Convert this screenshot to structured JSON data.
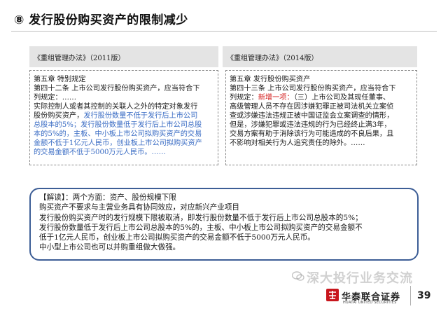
{
  "title": "⑧ 发行股份购买资产的限制减少",
  "columns": {
    "left_header": "《重组管理办法》（2011版）",
    "right_header": "《重组管理办法》（2014版）"
  },
  "left_box": {
    "lines": [
      {
        "segments": [
          {
            "text": "第五章 特别规定",
            "style": "plain"
          }
        ]
      },
      {
        "segments": [
          {
            "text": "第四十二条 上市公司发行股份购买资产，应当符合下",
            "style": "plain"
          }
        ]
      },
      {
        "segments": [
          {
            "text": "列规定：……",
            "style": "plain"
          }
        ]
      },
      {
        "segments": [
          {
            "text": "实际控制人或者其控制的关联人之外的特定对象发行",
            "style": "plain"
          }
        ]
      },
      {
        "segments": [
          {
            "text": "股份购买资产，",
            "style": "plain"
          },
          {
            "text": "发行股份数量不低于发行后上市公司",
            "style": "hl"
          }
        ]
      },
      {
        "segments": [
          {
            "text": "总股本的5%；发行股份数量低于发行后上市公司总股",
            "style": "hl"
          }
        ]
      },
      {
        "segments": [
          {
            "text": "本的5%的，主板、中小板上市公司拟购买资产的交易",
            "style": "hl"
          }
        ]
      },
      {
        "segments": [
          {
            "text": "金额不低于1亿元人民币，创业板上市公司拟购买资产",
            "style": "hl"
          }
        ]
      },
      {
        "segments": [
          {
            "text": "的交易金额不低于5000万元人民币。……",
            "style": "hl"
          }
        ]
      }
    ]
  },
  "right_box": {
    "lines": [
      {
        "segments": [
          {
            "text": "第五章 发行股份购买资产",
            "style": "plain"
          }
        ]
      },
      {
        "segments": [
          {
            "text": "第四十三条 上市公司发行股份购买资产，应当符合下",
            "style": "plain"
          }
        ]
      },
      {
        "segments": [
          {
            "text": "列规定：",
            "style": "plain"
          },
          {
            "text": "新增一项：",
            "style": "red"
          },
          {
            "text": "（三）上市公司及其现任董事、",
            "style": "plain"
          }
        ]
      },
      {
        "segments": [
          {
            "text": "高级管理人员不存在因涉嫌犯罪正被司法机关立案侦",
            "style": "plain"
          }
        ]
      },
      {
        "segments": [
          {
            "text": "查或涉嫌违法违规正被中国证监会立案调查的情形，",
            "style": "plain"
          }
        ]
      },
      {
        "segments": [
          {
            "text": "但是，涉嫌犯罪或违法违规的行为已经终止满3年，",
            "style": "plain"
          }
        ]
      },
      {
        "segments": [
          {
            "text": "交易方案有助于消除该行为可能造成的不良后果，且",
            "style": "plain"
          }
        ]
      },
      {
        "segments": [
          {
            "text": "不影响对相关行为人追究责任的除外。……",
            "style": "plain"
          }
        ]
      }
    ]
  },
  "note": {
    "lines": [
      "【解读】：两个方面：资产、股份规模下限",
      "购买资产不要求与主营业务具有协同效应，对应新兴产业项目",
      "发行股份购买资产时的发行规模下限被取消，即发行股份数量不低于发行后上市公司总股本的5%；",
      "发行股份数量低于发行后上市公司总股本的5%的，主板、中小板上市公司拟购买资产的交易金额不",
      "低于1亿元人民币，创业板上市公司拟购买资产的交易金额不低于5000万元人民币。",
      "中小型上市公司也可以并购重组做大做强。"
    ]
  },
  "footer": {
    "brand": "华泰联合证券",
    "brand_en": "HUATAI UNITED SECURITIES",
    "page_number": "39",
    "watermark": "深大投行业务交流"
  },
  "colors": {
    "highlight": "#3a6cc4",
    "new_item": "#d42020",
    "note_border": "#3d5e96",
    "brand_red": "#c8161d"
  }
}
